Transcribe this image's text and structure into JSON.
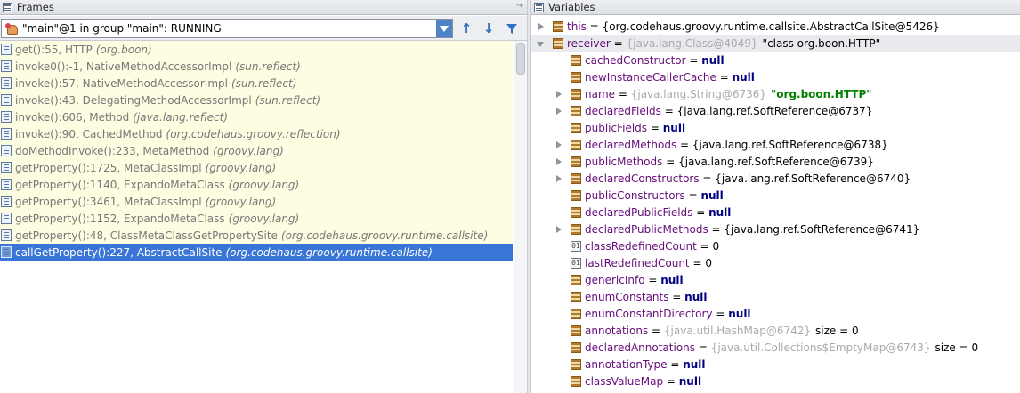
{
  "frames_panel": {
    "title": "Frames",
    "thread_label": "\"main\"@1 in group \"main\": RUNNING",
    "frames": [
      {
        "method": "get():55, HTTP",
        "cls": "(org.boon)",
        "selected": false
      },
      {
        "method": "invoke0():-1, NativeMethodAccessorImpl",
        "cls": "(sun.reflect)",
        "selected": false
      },
      {
        "method": "invoke():57, NativeMethodAccessorImpl",
        "cls": "(sun.reflect)",
        "selected": false
      },
      {
        "method": "invoke():43, DelegatingMethodAccessorImpl",
        "cls": "(sun.reflect)",
        "selected": false
      },
      {
        "method": "invoke():606, Method",
        "cls": "(java.lang.reflect)",
        "selected": false
      },
      {
        "method": "invoke():90, CachedMethod",
        "cls": "(org.codehaus.groovy.reflection)",
        "selected": false
      },
      {
        "method": "doMethodInvoke():233, MetaMethod",
        "cls": "(groovy.lang)",
        "selected": false
      },
      {
        "method": "getProperty():1725, MetaClassImpl",
        "cls": "(groovy.lang)",
        "selected": false
      },
      {
        "method": "getProperty():1140, ExpandoMetaClass",
        "cls": "(groovy.lang)",
        "selected": false
      },
      {
        "method": "getProperty():3461, MetaClassImpl",
        "cls": "(groovy.lang)",
        "selected": false
      },
      {
        "method": "getProperty():1152, ExpandoMetaClass",
        "cls": "(groovy.lang)",
        "selected": false
      },
      {
        "method": "getProperty():48, ClassMetaClassGetPropertySite",
        "cls": "(org.codehaus.groovy.runtime.callsite)",
        "selected": false
      },
      {
        "method": "callGetProperty():227, AbstractCallSite",
        "cls": "(org.codehaus.groovy.runtime.callsite)",
        "selected": true
      }
    ]
  },
  "variables_panel": {
    "title": "Variables",
    "vars": [
      {
        "level": 0,
        "expander": "right",
        "icon": "field",
        "name": "this",
        "ref": "",
        "value": "{org.codehaus.groovy.runtime.callsite.AbstractCallSite@5426}",
        "vtype": "plain",
        "selected": false
      },
      {
        "level": 0,
        "expander": "down",
        "icon": "field",
        "name": "receiver",
        "ref": "{java.lang.Class@4049}",
        "value": "\"class org.boon.HTTP\"",
        "vtype": "plain",
        "selected": true
      },
      {
        "level": 1,
        "expander": "none",
        "icon": "field",
        "name": "cachedConstructor",
        "ref": "",
        "value": "null",
        "vtype": "null",
        "selected": false
      },
      {
        "level": 1,
        "expander": "none",
        "icon": "field",
        "name": "newInstanceCallerCache",
        "ref": "",
        "value": "null",
        "vtype": "null",
        "selected": false
      },
      {
        "level": 1,
        "expander": "right",
        "icon": "field",
        "name": "name",
        "ref": "{java.lang.String@6736}",
        "value": "\"org.boon.HTTP\"",
        "vtype": "string",
        "selected": false
      },
      {
        "level": 1,
        "expander": "right",
        "icon": "field",
        "name": "declaredFields",
        "ref": "",
        "value": "{java.lang.ref.SoftReference@6737}",
        "vtype": "plain",
        "selected": false
      },
      {
        "level": 1,
        "expander": "none",
        "icon": "field",
        "name": "publicFields",
        "ref": "",
        "value": "null",
        "vtype": "null",
        "selected": false
      },
      {
        "level": 1,
        "expander": "right",
        "icon": "field",
        "name": "declaredMethods",
        "ref": "",
        "value": "{java.lang.ref.SoftReference@6738}",
        "vtype": "plain",
        "selected": false
      },
      {
        "level": 1,
        "expander": "right",
        "icon": "field",
        "name": "publicMethods",
        "ref": "",
        "value": "{java.lang.ref.SoftReference@6739}",
        "vtype": "plain",
        "selected": false
      },
      {
        "level": 1,
        "expander": "right",
        "icon": "field",
        "name": "declaredConstructors",
        "ref": "",
        "value": "{java.lang.ref.SoftReference@6740}",
        "vtype": "plain",
        "selected": false
      },
      {
        "level": 1,
        "expander": "none",
        "icon": "field",
        "name": "publicConstructors",
        "ref": "",
        "value": "null",
        "vtype": "null",
        "selected": false
      },
      {
        "level": 1,
        "expander": "none",
        "icon": "field",
        "name": "declaredPublicFields",
        "ref": "",
        "value": "null",
        "vtype": "null",
        "selected": false
      },
      {
        "level": 1,
        "expander": "right",
        "icon": "field",
        "name": "declaredPublicMethods",
        "ref": "",
        "value": "{java.lang.ref.SoftReference@6741}",
        "vtype": "plain",
        "selected": false
      },
      {
        "level": 1,
        "expander": "none",
        "icon": "prim",
        "name": "classRedefinedCount",
        "ref": "",
        "value": "0",
        "vtype": "plain",
        "selected": false
      },
      {
        "level": 1,
        "expander": "none",
        "icon": "prim",
        "name": "lastRedefinedCount",
        "ref": "",
        "value": "0",
        "vtype": "plain",
        "selected": false
      },
      {
        "level": 1,
        "expander": "none",
        "icon": "field",
        "name": "genericInfo",
        "ref": "",
        "value": "null",
        "vtype": "null",
        "selected": false
      },
      {
        "level": 1,
        "expander": "none",
        "icon": "field",
        "name": "enumConstants",
        "ref": "",
        "value": "null",
        "vtype": "null",
        "selected": false
      },
      {
        "level": 1,
        "expander": "none",
        "icon": "field",
        "name": "enumConstantDirectory",
        "ref": "",
        "value": "null",
        "vtype": "null",
        "selected": false
      },
      {
        "level": 1,
        "expander": "none",
        "icon": "field",
        "name": "annotations",
        "ref": "{java.util.HashMap@6742}",
        "value": "size = 0",
        "vtype": "plain",
        "selected": false
      },
      {
        "level": 1,
        "expander": "none",
        "icon": "field",
        "name": "declaredAnnotations",
        "ref": "{java.util.Collections$EmptyMap@6743}",
        "value": "size = 0",
        "vtype": "plain",
        "selected": false
      },
      {
        "level": 1,
        "expander": "none",
        "icon": "field",
        "name": "annotationType",
        "ref": "",
        "value": "null",
        "vtype": "null",
        "selected": false
      },
      {
        "level": 1,
        "expander": "none",
        "icon": "field",
        "name": "classValueMap",
        "ref": "",
        "value": "null",
        "vtype": "null",
        "selected": false
      }
    ]
  },
  "icons": {
    "frames_title": "frames-icon",
    "thread": "thread-icon",
    "up": "arrow-up-icon",
    "down": "arrow-down-icon",
    "filter": "filter-icon",
    "pin": "pin-icon",
    "variables_title": "variables-icon"
  },
  "colors": {
    "selection": "#3875d7",
    "frame_background": "#fdfde2",
    "field_name": "#660e7a",
    "null_keyword": "#000080",
    "string_value": "#008000",
    "reference": "#aaaaaa"
  }
}
